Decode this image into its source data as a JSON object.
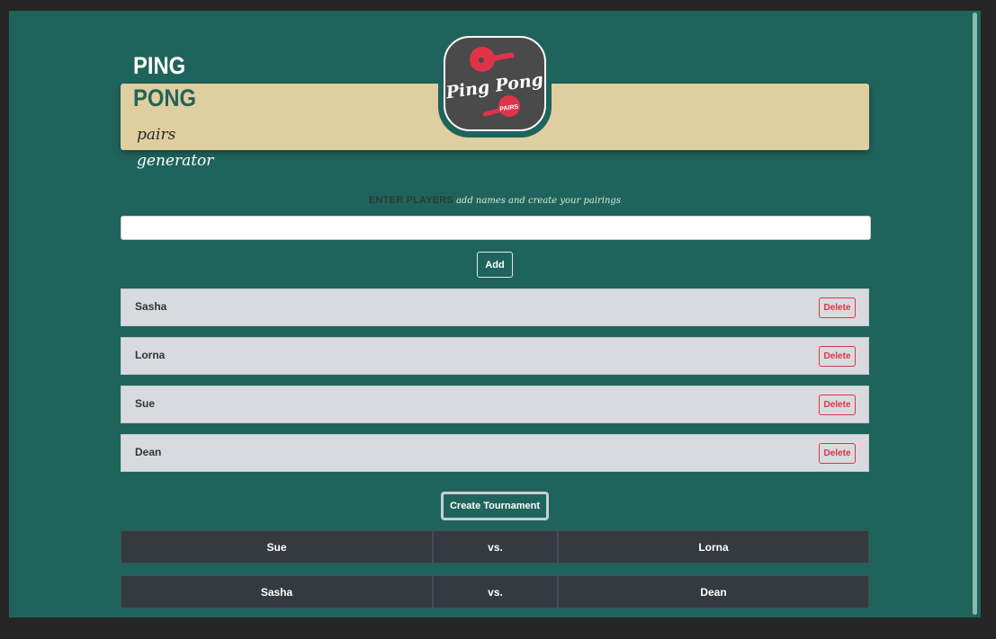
{
  "brand": {
    "title_line1": "PING",
    "title_line2": "PONG",
    "subtitle_line1": "pairs",
    "subtitle_line2": "generator",
    "logo_text_main": "Ping Pong",
    "logo_text_badge": "PAIRS"
  },
  "entry": {
    "label": "ENTER PLAYERS",
    "hint": "add names and create your pairings",
    "input_value": "",
    "input_placeholder": "",
    "add_label": "Add"
  },
  "players": [
    {
      "name": "Sasha",
      "delete_label": "Delete"
    },
    {
      "name": "Lorna",
      "delete_label": "Delete"
    },
    {
      "name": "Sue",
      "delete_label": "Delete"
    },
    {
      "name": "Dean",
      "delete_label": "Delete"
    }
  ],
  "tournament": {
    "create_label": "Create Tournament",
    "pairings": [
      {
        "player_a": "Sue",
        "vs": "vs.",
        "player_b": "Lorna"
      },
      {
        "player_a": "Sasha",
        "vs": "vs.",
        "player_b": "Dean"
      }
    ]
  },
  "colors": {
    "background": "#1f645c",
    "banner": "#dfce9f",
    "row_light": "#d9dadf",
    "row_dark": "#343a40",
    "danger": "#dc3545",
    "logo_red": "#e0334a",
    "logo_gray": "#4a4a4a"
  }
}
